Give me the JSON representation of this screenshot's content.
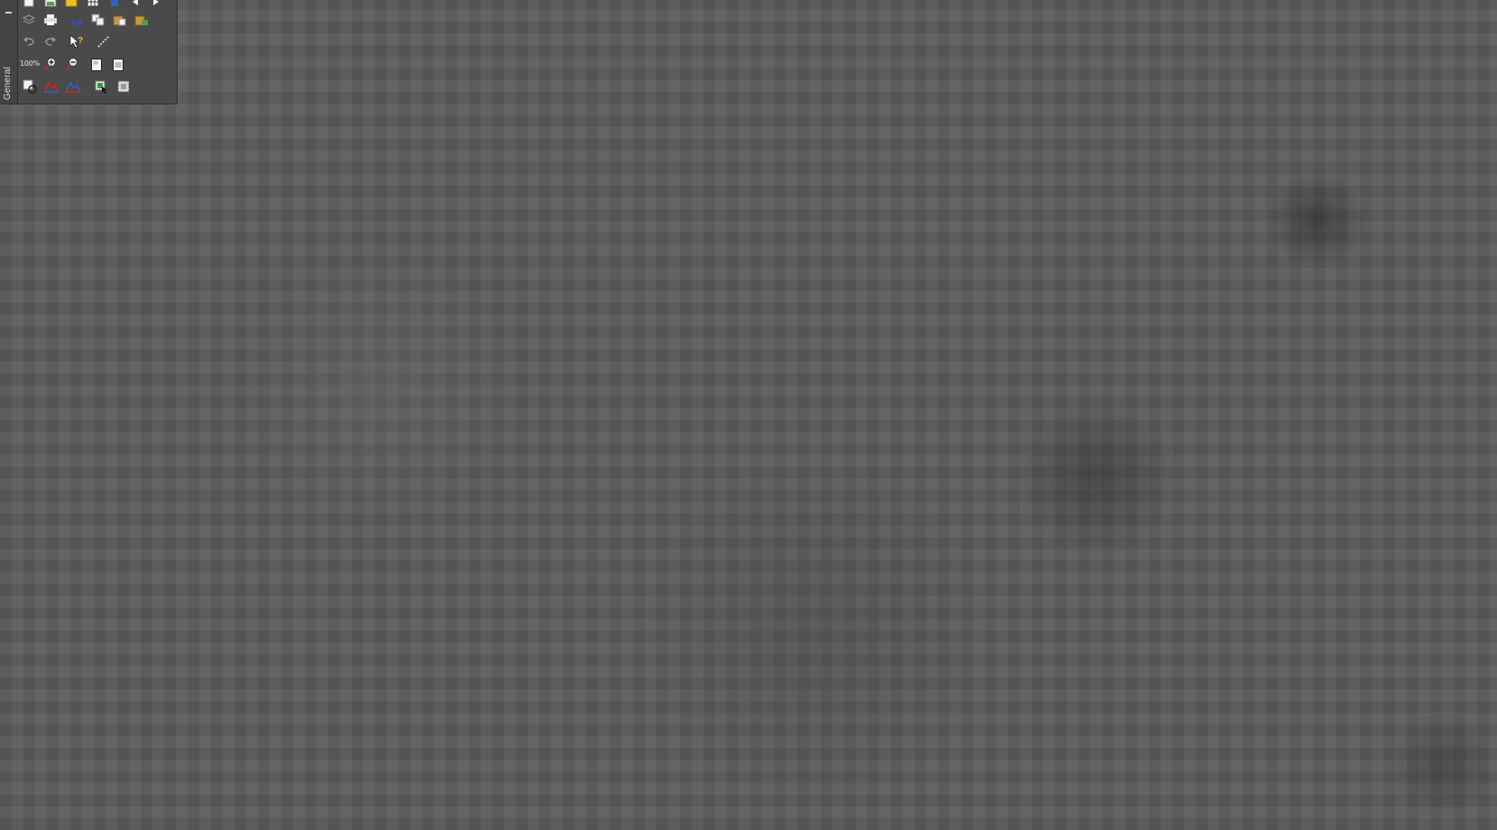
{
  "panel": {
    "tab_label": "General",
    "zoom_label": "100%"
  },
  "icons": {
    "row0": [
      "new-icon",
      "save-icon",
      "open-folder-icon",
      "grid-icon",
      "info-icon",
      "arrow-left-icon",
      "arrow-right-icon"
    ],
    "row1": [
      "layers-icon",
      "print-icon",
      "cut-icon",
      "copy-icon",
      "paste-icon",
      "paste-special-icon"
    ],
    "row2": [
      "undo-icon",
      "redo-icon",
      "help-icon",
      "measure-icon"
    ],
    "row3": [
      "zoom-in-icon",
      "zoom-out-icon",
      "fit-page-icon",
      "fit-width-icon"
    ],
    "row4": [
      "refresh-icon",
      "mountain-red-icon",
      "mountain-blue-icon",
      "select-icon",
      "frame-icon"
    ]
  },
  "colors": {
    "workspace": "#5a5a5a",
    "panel": "#4a4a4a",
    "icon_red": "#e02020",
    "icon_blue": "#3060d0",
    "icon_yellow": "#f0c020"
  }
}
